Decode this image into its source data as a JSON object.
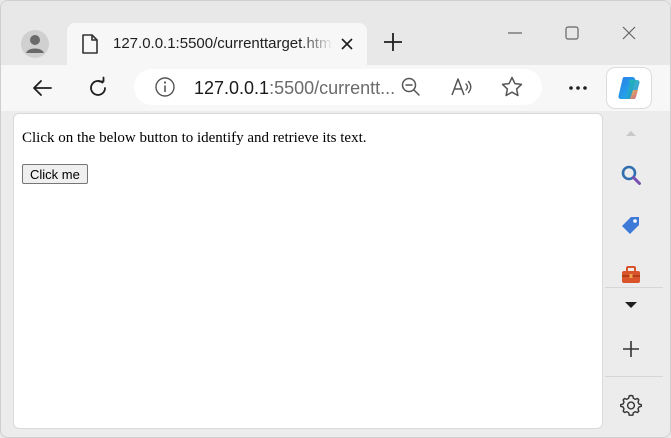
{
  "browser": {
    "tab": {
      "title": "127.0.0.1:5500/currenttarget.html"
    },
    "address": {
      "host": "127.0.0.1",
      "rest": ":5500/currentt..."
    }
  },
  "page": {
    "instruction": "Click on the below button to identify and retrieve its text.",
    "button_label": "Click me"
  },
  "icons": {
    "profile": "profile-icon",
    "favicon": "page-icon",
    "close": "close-icon",
    "new_tab": "plus-icon",
    "minimize": "minimize-icon",
    "maximize": "maximize-icon",
    "window_close": "close-icon",
    "back": "back-arrow-icon",
    "refresh": "refresh-icon",
    "info": "info-icon",
    "zoom_out": "zoom-out-icon",
    "read_aloud": "read-aloud-icon",
    "favorite": "star-icon",
    "more": "more-icon",
    "copilot": "copilot-icon"
  },
  "colors": {
    "tab_strip": "#e8e8e8",
    "toolbar": "#f7f7f7",
    "accent_blue": "#1a73e8"
  }
}
